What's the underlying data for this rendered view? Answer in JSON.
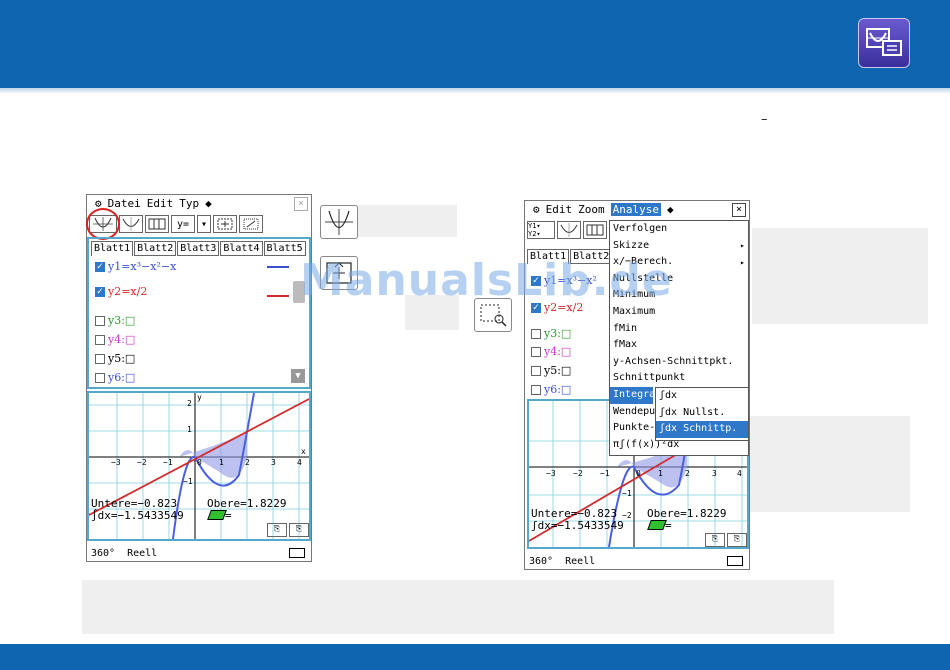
{
  "header": {
    "accent": "#0f66b0"
  },
  "page": {
    "dash": "–",
    "watermark": "ManualsLib.de"
  },
  "left_calc": {
    "menu": {
      "gear": "⚙",
      "datei": "Datei",
      "edit": "Edit",
      "typ": "Typ",
      "arrow": "◆",
      "close": "×"
    },
    "toolbar": {
      "yeq": "y=",
      "dropdown": "▾",
      "more": "▸"
    },
    "tabs": [
      "Blatt1",
      "Blatt2",
      "Blatt3",
      "Blatt4",
      "Blatt5"
    ],
    "equations": [
      {
        "label": "y1=x³−x²−x",
        "checked": true,
        "color": "#3a4fd0"
      },
      {
        "label": "y2=x/2",
        "checked": true,
        "color": "#d22b2b"
      },
      {
        "label": "y3:□",
        "checked": false,
        "color": "#2a9a2a"
      },
      {
        "label": "y4:□",
        "checked": false,
        "color": "#cc33cc"
      },
      {
        "label": "y5:□",
        "checked": false,
        "color": "#000000"
      },
      {
        "label": "y6:□",
        "checked": false,
        "color": "#3a4fd0"
      }
    ],
    "graph": {
      "x_ticks": [
        "−3",
        "−2",
        "−1",
        "0",
        "1",
        "2",
        "3",
        "4"
      ],
      "y_ticks": [
        "2",
        "1",
        "−1",
        "−2"
      ],
      "x_label": "x",
      "y_label": "y"
    },
    "result": {
      "lower": "Untere=−0.823",
      "upper": "Obere=1.8229",
      "integral": "∫dx=−1.5433549",
      "eq": "="
    },
    "status": {
      "angle": "360°",
      "mode": "Reell"
    }
  },
  "mid_icons": {
    "graph_icon": "graph-icon",
    "view_window_icon": "view-window-icon",
    "zoom_box_icon": "zoom-box-icon"
  },
  "right_calc": {
    "menu": {
      "gear": "⚙",
      "edit": "Edit",
      "zoom": "Zoom",
      "analyse": "Analyse",
      "arrow": "◆",
      "close": "×"
    },
    "toolbar": {
      "y12": "Y1▾ Y2▾",
      "more": "▸"
    },
    "tabs": [
      "Blatt1",
      "Blatt2",
      "B"
    ],
    "equations": [
      {
        "label": "y1=x³−x²",
        "checked": true,
        "color": "#3a4fd0"
      },
      {
        "label": "y2=x/2",
        "checked": true,
        "color": "#d22b2b"
      },
      {
        "label": "y3:□",
        "checked": false,
        "color": "#2a9a2a"
      },
      {
        "label": "y4:□",
        "checked": false,
        "color": "#cc33cc"
      },
      {
        "label": "y5:□",
        "checked": false,
        "color": "#000000"
      },
      {
        "label": "y6:□",
        "checked": false,
        "color": "#3a4fd0"
      }
    ],
    "analyse_menu": [
      "Verfolgen",
      "Skizze",
      "x/−Berech.",
      "Nullstelle",
      "Minimum",
      "Maximum",
      "fMin",
      "fMax",
      "y-Achsen-Schnittpkt.",
      "Schnittpunkt",
      "Integral",
      "Wendepunkt",
      "Punkte-A",
      "πʃ(f(x))²dx"
    ],
    "integral_submenu": [
      "ʃdx",
      "ʃdx Nullst.",
      "ʃdx Schnittp."
    ],
    "graph": {
      "x_ticks": [
        "−3",
        "−2",
        "−1",
        "0",
        "1",
        "2",
        "3",
        "4"
      ],
      "y_ticks": [
        "−1",
        "−2"
      ]
    },
    "result": {
      "lower": "Untere=−0.823",
      "upper": "Obere=1.8229",
      "integral": "ʃdx=−1.5433549",
      "eq": "="
    },
    "status": {
      "angle": "360°",
      "mode": "Reell"
    }
  }
}
